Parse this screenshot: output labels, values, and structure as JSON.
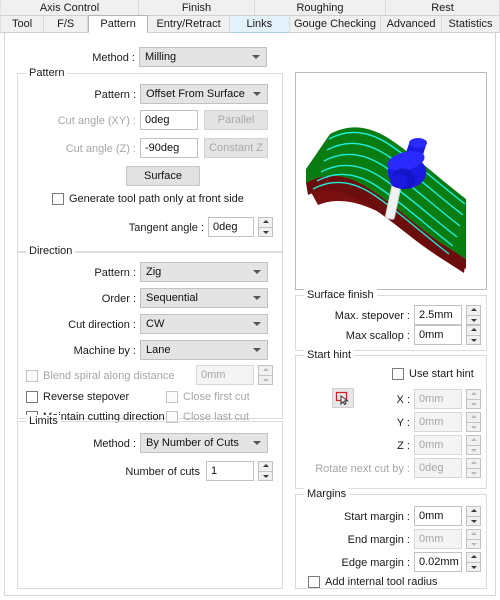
{
  "tabs": {
    "row1": [
      {
        "label": "Axis Control",
        "state": "normal"
      },
      {
        "label": "Finish",
        "state": "normal"
      },
      {
        "label": "Roughing",
        "state": "normal"
      },
      {
        "label": "Rest",
        "state": "normal"
      }
    ],
    "row2": [
      {
        "label": "Tool",
        "state": "normal"
      },
      {
        "label": "F/S",
        "state": "normal"
      },
      {
        "label": "Pattern",
        "state": "selected"
      },
      {
        "label": "Entry/Retract",
        "state": "normal"
      },
      {
        "label": "Links",
        "state": "hovered"
      },
      {
        "label": "Gouge Checking",
        "state": "normal"
      },
      {
        "label": "Advanced",
        "state": "normal"
      },
      {
        "label": "Statistics",
        "state": "normal"
      }
    ]
  },
  "method": {
    "label": "Method :",
    "value": "Milling"
  },
  "pattern_group": {
    "title": "Pattern",
    "pattern_label": "Pattern :",
    "pattern_value": "Offset From Surface",
    "cut_angle_xy_label": "Cut angle (XY) :",
    "cut_angle_xy_value": "0deg",
    "parallel_button": "Parallel",
    "cut_angle_z_label": "Cut angle (Z) :",
    "cut_angle_z_value": "-90deg",
    "constant_z_button": "Constant Z",
    "surface_button": "Surface",
    "front_side_checkbox": "Generate tool path only at front side",
    "tangent_angle_label": "Tangent angle :",
    "tangent_angle_value": "0deg"
  },
  "direction_group": {
    "title": "Direction",
    "pattern_label": "Pattern :",
    "pattern_value": "Zig",
    "order_label": "Order :",
    "order_value": "Sequential",
    "cut_direction_label": "Cut direction :",
    "cut_direction_value": "CW",
    "machine_by_label": "Machine by :",
    "machine_by_value": "Lane",
    "blend_spiral_checkbox": "Blend spiral along distance",
    "blend_spiral_value": "0mm",
    "reverse_stepover_checkbox": "Reverse stepover",
    "close_first_cut_checkbox": "Close first cut",
    "maintain_cutting_direction_checkbox": "Maintain cutting direction",
    "close_last_cut_checkbox": "Close last cut"
  },
  "limits_group": {
    "title": "Limits",
    "method_label": "Method :",
    "method_value": "By Number of Cuts",
    "number_of_cuts_label": "Number of cuts",
    "number_of_cuts_value": "1"
  },
  "preview": {
    "name": "toolpath-3d-preview",
    "surface_top_color": "#0a7d12",
    "surface_side_color": "#7a0f0f",
    "toolpath_color": "#1ef0e0",
    "tool_color": "#1a1ae0",
    "tool_shank_color": "#f2f2f2"
  },
  "surface_finish_group": {
    "title": "Surface finish",
    "max_stepover_label": "Max. stepover :",
    "max_stepover_value": "2.5mm",
    "max_scallop_label": "Max scallop :",
    "max_scallop_value": "0mm"
  },
  "start_hint_group": {
    "title": "Start hint",
    "use_start_hint_checkbox": "Use start hint",
    "pick_icon": "pick-point-icon",
    "x_label": "X :",
    "x_value": "0mm",
    "y_label": "Y :",
    "y_value": "0mm",
    "z_label": "Z :",
    "z_value": "0mm",
    "rotate_label": "Rotate next cut by :",
    "rotate_value": "0deg"
  },
  "margins_group": {
    "title": "Margins",
    "start_margin_label": "Start margin :",
    "start_margin_value": "0mm",
    "end_margin_label": "End margin :",
    "end_margin_value": "0mm",
    "edge_margin_label": "Edge margin :",
    "edge_margin_value": "0.02mm",
    "add_internal_tool_radius_checkbox": "Add internal tool radius"
  }
}
